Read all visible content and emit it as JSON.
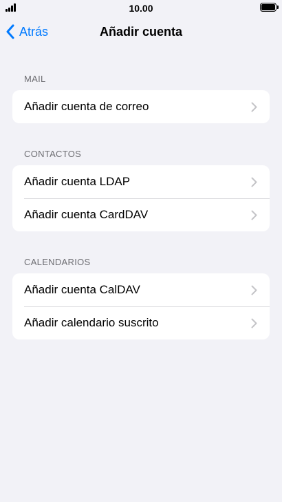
{
  "status_bar": {
    "time": "10.00"
  },
  "nav": {
    "back_label": "Atrás",
    "title": "Añadir cuenta"
  },
  "sections": [
    {
      "header": "MAIL",
      "items": [
        {
          "label": "Añadir cuenta de correo"
        }
      ]
    },
    {
      "header": "CONTACTOS",
      "items": [
        {
          "label": "Añadir cuenta LDAP"
        },
        {
          "label": "Añadir cuenta CardDAV"
        }
      ]
    },
    {
      "header": "CALENDARIOS",
      "items": [
        {
          "label": "Añadir cuenta CalDAV"
        },
        {
          "label": "Añadir calendario suscrito"
        }
      ]
    }
  ],
  "colors": {
    "accent": "#007aff",
    "background": "#f2f2f7",
    "chevron": "#c4c4c7"
  },
  "icons": {
    "back": "chevron-left-icon",
    "row": "chevron-right-icon"
  }
}
